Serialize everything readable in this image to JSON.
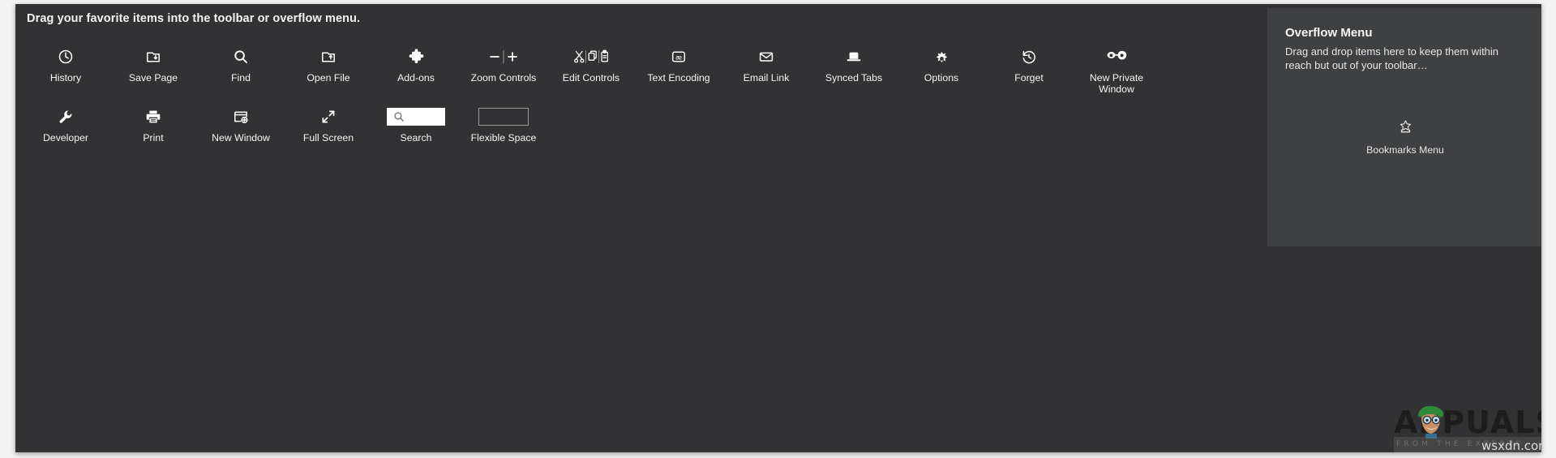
{
  "instruction": "Drag your favorite items into the toolbar or overflow menu.",
  "palette": {
    "row1": [
      {
        "label": "History",
        "icon": "history-icon"
      },
      {
        "label": "Save Page",
        "icon": "save-page-icon"
      },
      {
        "label": "Find",
        "icon": "find-icon"
      },
      {
        "label": "Open File",
        "icon": "open-file-icon"
      },
      {
        "label": "Add-ons",
        "icon": "addons-puzzle-icon"
      },
      {
        "label": "Zoom Controls",
        "icon": "zoom-controls-icon"
      },
      {
        "label": "Edit Controls",
        "icon": "edit-controls-icon"
      },
      {
        "label": "Text Encoding",
        "icon": "text-encoding-icon"
      },
      {
        "label": "Email Link",
        "icon": "email-link-icon"
      },
      {
        "label": "Synced Tabs",
        "icon": "synced-tabs-icon"
      },
      {
        "label": "Options",
        "icon": "options-gear-icon"
      },
      {
        "label": "Forget",
        "icon": "forget-icon"
      },
      {
        "label": "New Private Window",
        "icon": "private-window-mask-icon"
      }
    ],
    "row2": [
      {
        "label": "Developer",
        "icon": "developer-wrench-icon"
      },
      {
        "label": "Print",
        "icon": "print-icon"
      },
      {
        "label": "New Window",
        "icon": "new-window-icon"
      },
      {
        "label": "Full Screen",
        "icon": "full-screen-icon"
      },
      {
        "label": "Search",
        "icon": "search-icon"
      },
      {
        "label": "Flexible Space",
        "icon": "flexible-space-icon"
      }
    ]
  },
  "overflow": {
    "title": "Overflow Menu",
    "description": "Drag and drop items here to keep them within reach but out of your toolbar…",
    "items": [
      {
        "label": "Bookmarks Menu",
        "icon": "bookmarks-menu-star-icon"
      }
    ]
  },
  "watermark": {
    "brand": "APPUALS",
    "tagline": "FROM THE EXPERTS",
    "domain": "wsxdn.com"
  },
  "colors": {
    "surface": "#323234",
    "overflow_panel": "#3f4042",
    "text": "#f5f5f5",
    "search_field": "#ffffff",
    "flexible_space_border": "#9b9b9b"
  }
}
